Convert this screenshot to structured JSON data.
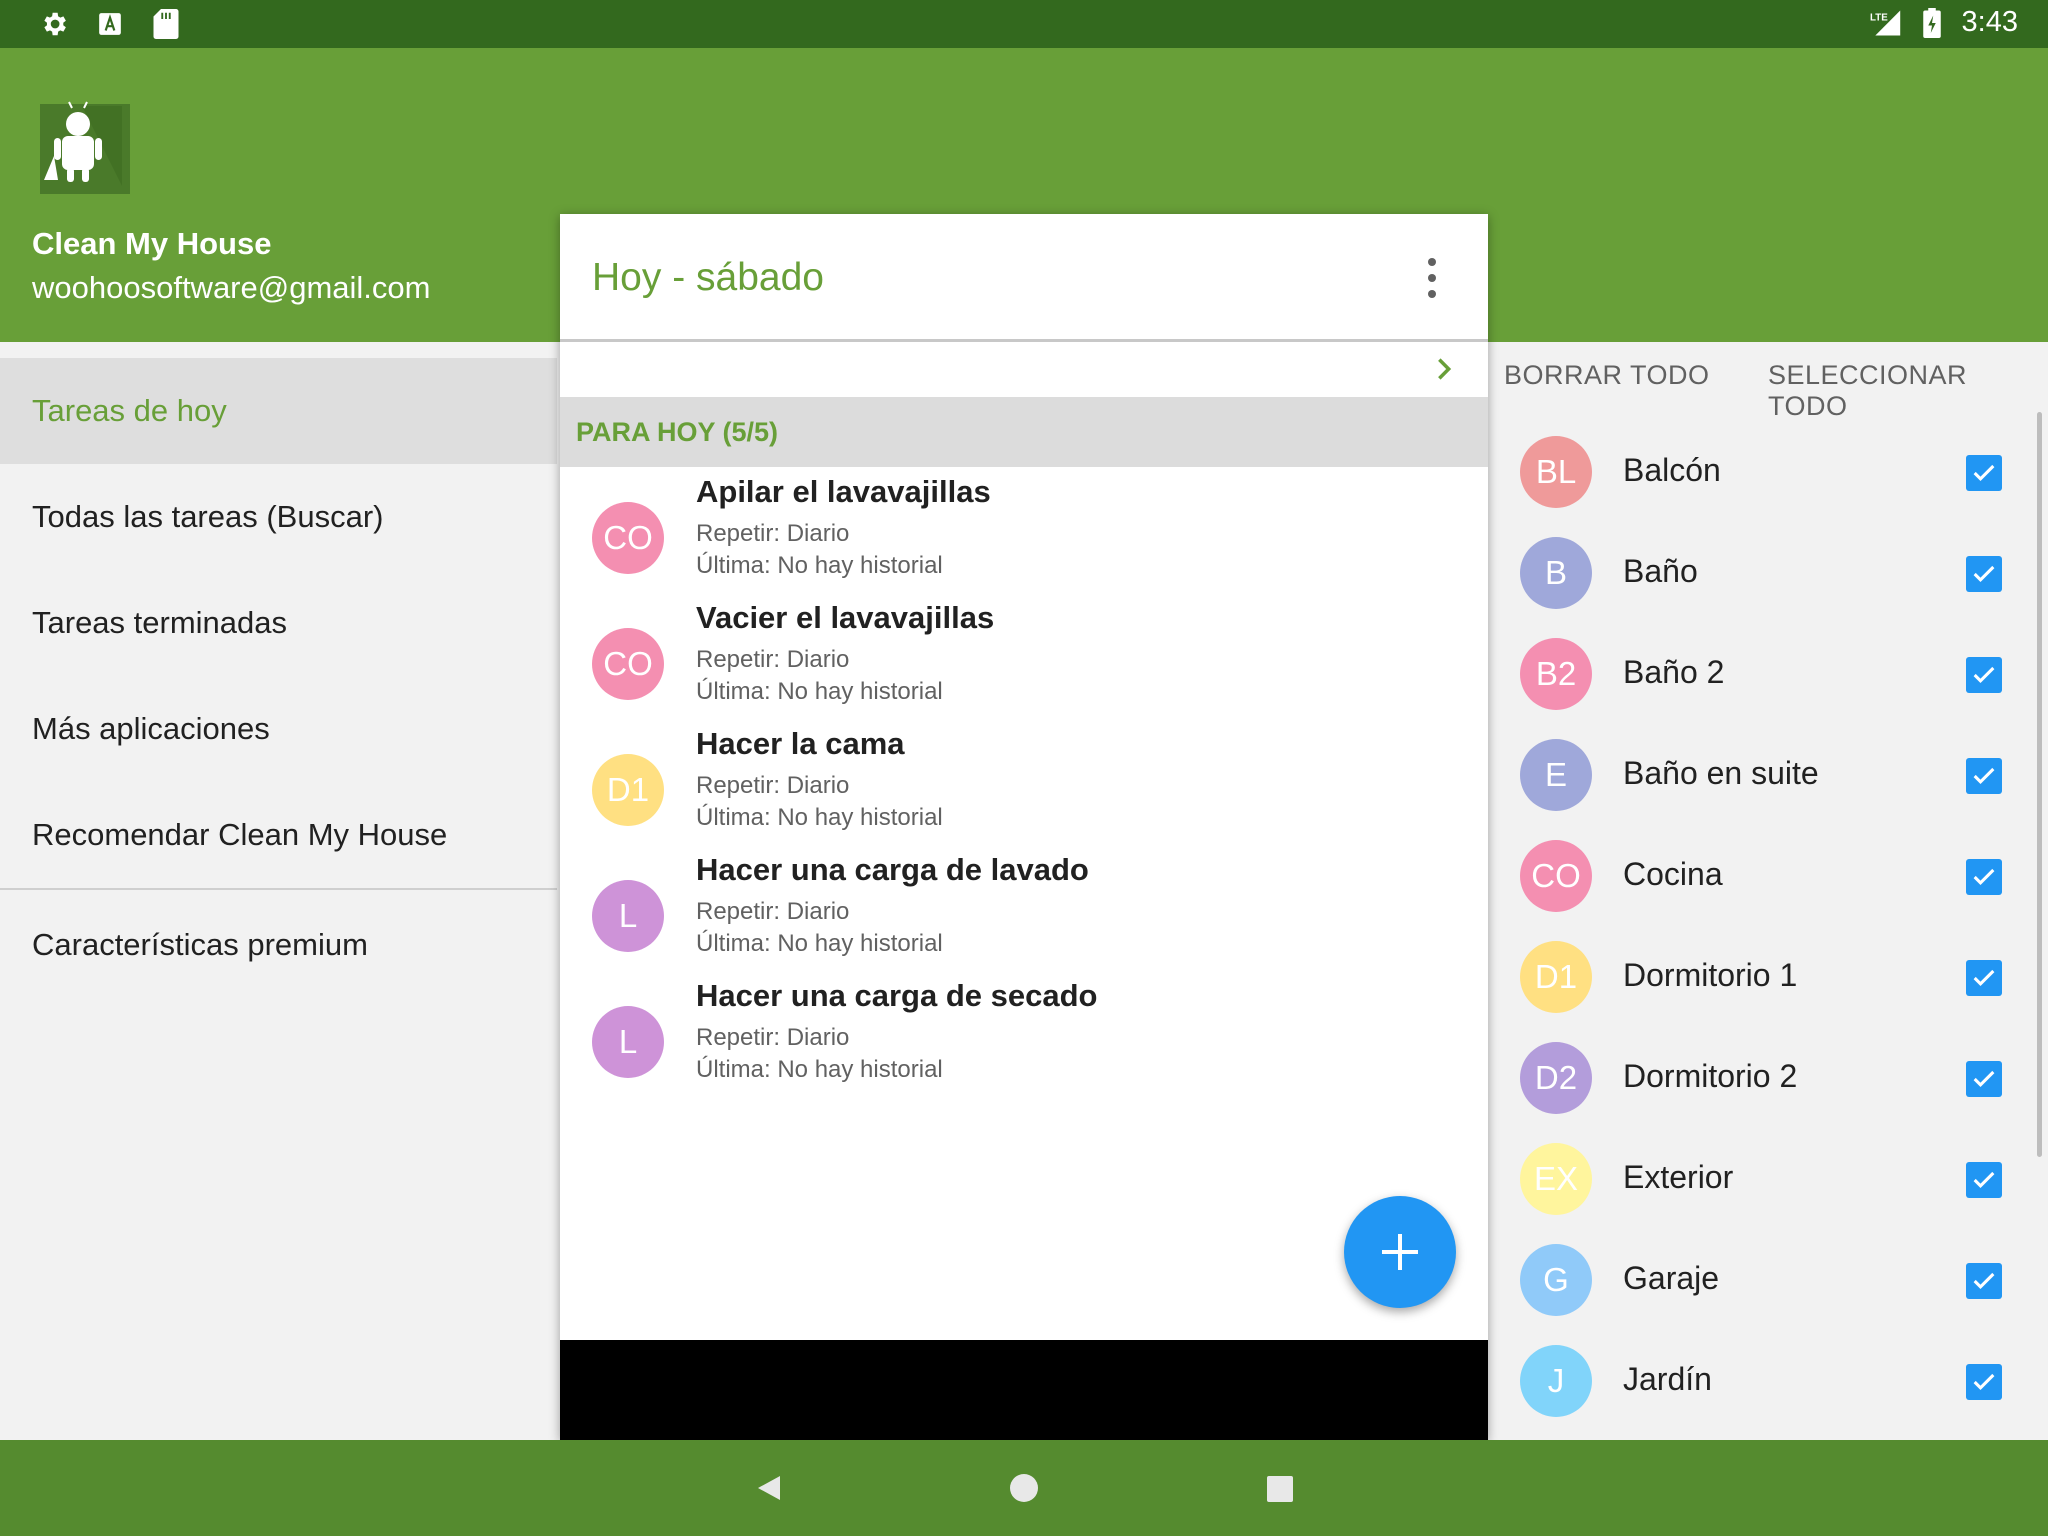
{
  "status_bar": {
    "time": "3:43",
    "left_icons": [
      "settings-icon",
      "text-a-icon",
      "sd-card-icon"
    ],
    "right_icons": [
      "lte-signal-icon",
      "battery-charging-icon"
    ],
    "lte_label": "LTE"
  },
  "drawer": {
    "app_name": "Clean My House",
    "email": "woohoosoftware@gmail.com",
    "items": [
      {
        "label": "Tareas de hoy",
        "active": true
      },
      {
        "label": "Todas las tareas (Buscar)"
      },
      {
        "label": "Tareas terminadas"
      },
      {
        "label": "Más aplicaciones"
      },
      {
        "label": "Recomendar Clean My House"
      }
    ],
    "premium_label": "Características premium"
  },
  "main": {
    "title": "Hoy - sábado",
    "section_title": "PARA HOY (5/5)",
    "tasks": [
      {
        "initials": "CO",
        "color": "#f48fb1",
        "title": "Apilar el lavavajillas",
        "repeat": "Repetir: Diario",
        "last": "Última: No hay historial"
      },
      {
        "initials": "CO",
        "color": "#f48fb1",
        "title": "Vacier el lavavajillas",
        "repeat": "Repetir: Diario",
        "last": "Última: No hay historial"
      },
      {
        "initials": "D1",
        "color": "#ffe082",
        "title": "Hacer la cama",
        "repeat": "Repetir: Diario",
        "last": "Última: No hay historial"
      },
      {
        "initials": "L",
        "color": "#ce93d8",
        "title": "Hacer una carga de lavado",
        "repeat": "Repetir: Diario",
        "last": "Última: No hay historial"
      },
      {
        "initials": "L",
        "color": "#ce93d8",
        "title": "Hacer una carga de secado",
        "repeat": "Repetir: Diario",
        "last": "Última: No hay historial"
      }
    ]
  },
  "filter_panel": {
    "clear_all": "BORRAR TODO",
    "select_all": "SELECCIONAR TODO",
    "rooms": [
      {
        "initials": "BL",
        "color": "#ef9a9a",
        "label": "Balcón",
        "checked": true
      },
      {
        "initials": "B",
        "color": "#9fa8da",
        "label": "Baño",
        "checked": true
      },
      {
        "initials": "B2",
        "color": "#f48fb1",
        "label": "Baño 2",
        "checked": true
      },
      {
        "initials": "E",
        "color": "#9fa8da",
        "label": "Baño en suite",
        "checked": true
      },
      {
        "initials": "CO",
        "color": "#f48fb1",
        "label": "Cocina",
        "checked": true
      },
      {
        "initials": "D1",
        "color": "#ffe082",
        "label": "Dormitorio 1",
        "checked": true
      },
      {
        "initials": "D2",
        "color": "#b39ddb",
        "label": "Dormitorio 2",
        "checked": true
      },
      {
        "initials": "EX",
        "color": "#fff59d",
        "label": "Exterior",
        "checked": true
      },
      {
        "initials": "G",
        "color": "#90caf9",
        "label": "Garaje",
        "checked": true
      },
      {
        "initials": "J",
        "color": "#81d4fa",
        "label": "Jardín",
        "checked": true
      }
    ]
  },
  "colors": {
    "primary": "#689f38",
    "primary_dark": "#33691e",
    "accent": "#2196f3"
  }
}
